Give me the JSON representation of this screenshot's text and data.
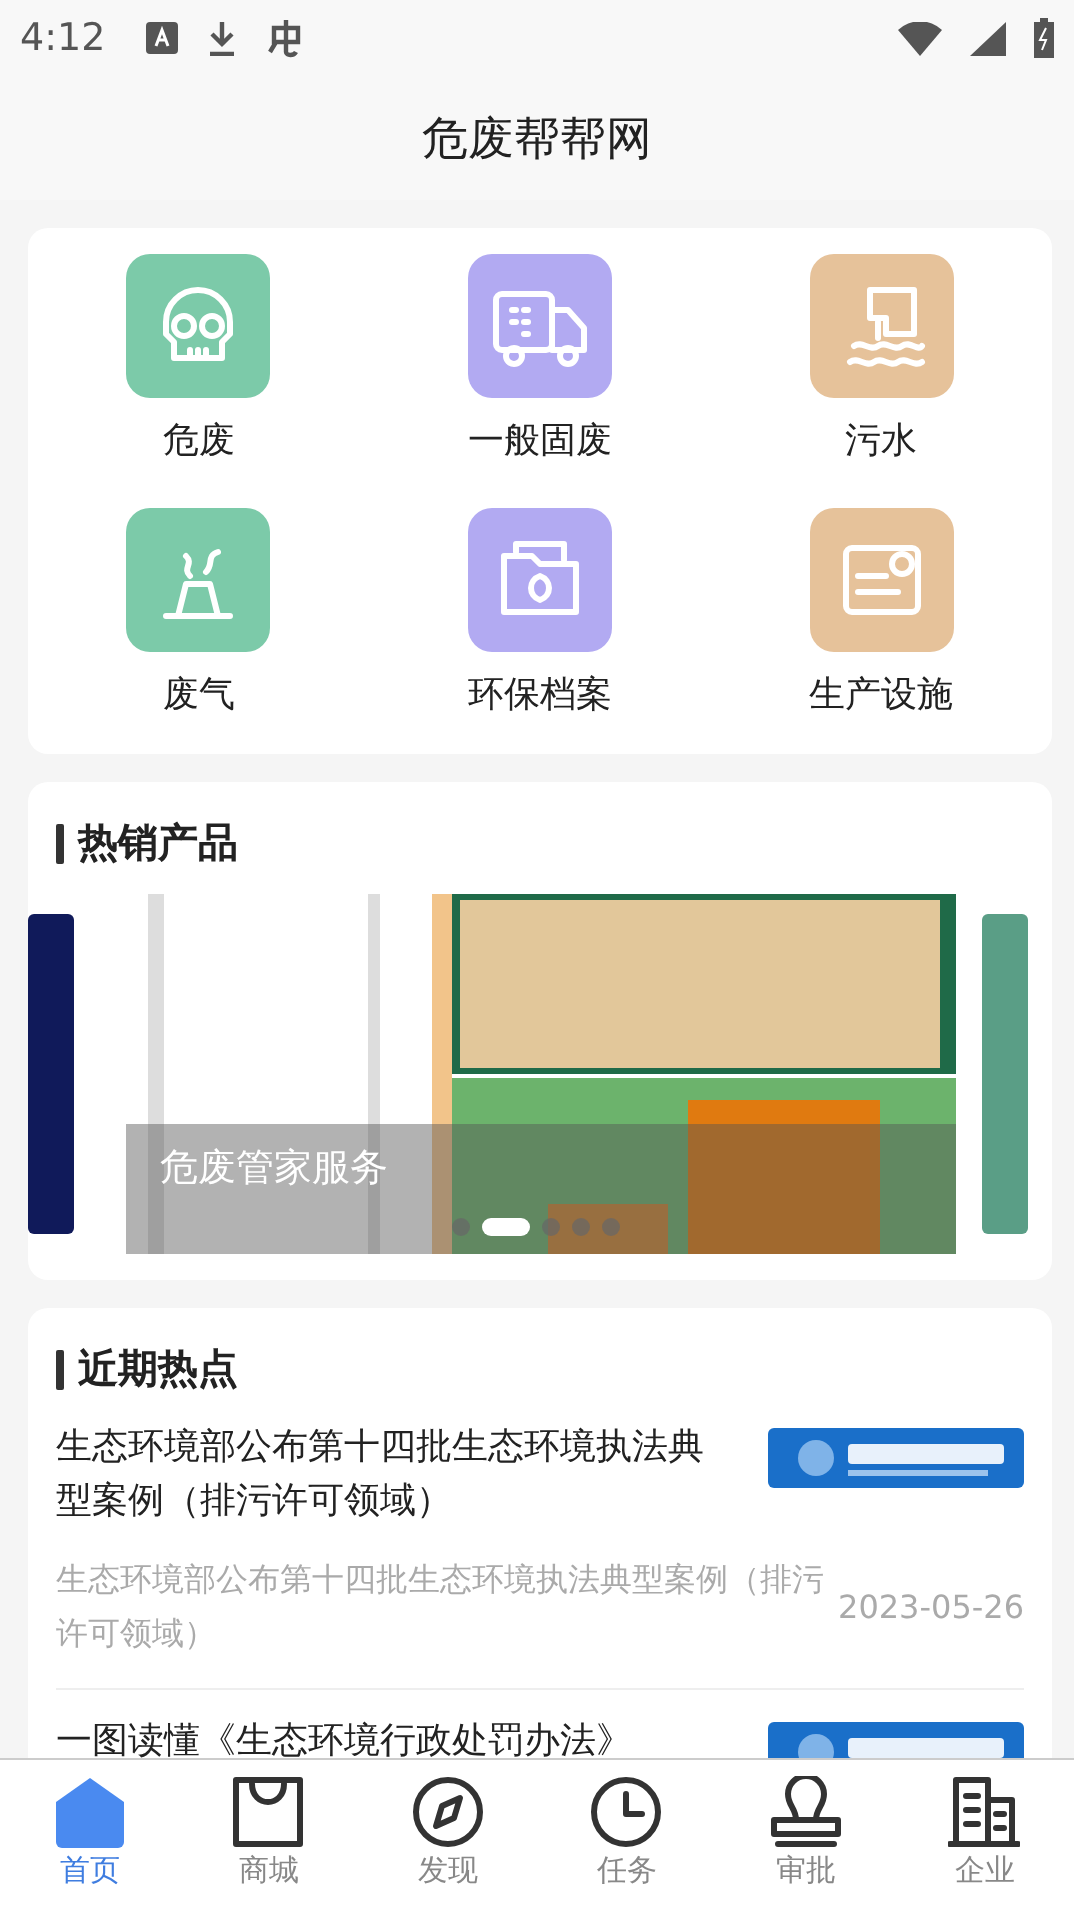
{
  "status_bar": {
    "time": "4:12"
  },
  "header": {
    "title": "危废帮帮网"
  },
  "categories": [
    {
      "label": "危废",
      "color": "#7ccaa9"
    },
    {
      "label": "一般固废",
      "color": "#b2aaf2"
    },
    {
      "label": "污水",
      "color": "#e6c29a"
    },
    {
      "label": "废气",
      "color": "#7ccaa9"
    },
    {
      "label": "环保档案",
      "color": "#b2aaf2"
    },
    {
      "label": "生产设施",
      "color": "#e6c29a"
    }
  ],
  "hot_products": {
    "title": "热销产品",
    "caption": "危废管家服务",
    "indicator": [
      {
        "selected": false
      },
      {
        "selected": true
      },
      {
        "selected": false
      },
      {
        "selected": false
      },
      {
        "selected": false
      }
    ]
  },
  "news": {
    "title": "近期热点",
    "items": [
      {
        "title": "生态环境部公布第十四批生态环境执法典型案例（排污许可领域）",
        "summary": "生态环境部公布第十四批生态环境执法典型案例（排污许可领域）",
        "date": "2023-05-26"
      },
      {
        "title": "一图读懂《生态环境行政处罚办法》"
      }
    ]
  },
  "tab_bar": [
    {
      "label": "首页",
      "selected": true
    },
    {
      "label": "商城",
      "selected": false
    },
    {
      "label": "发现",
      "selected": false
    },
    {
      "label": "任务",
      "selected": false
    },
    {
      "label": "审批",
      "selected": false
    },
    {
      "label": "企业",
      "selected": false
    }
  ]
}
